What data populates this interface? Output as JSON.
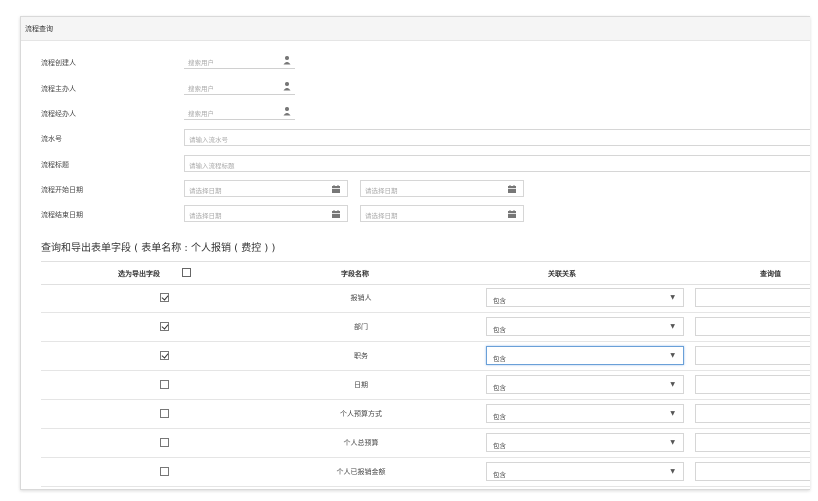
{
  "panel": {
    "title": "流程查询"
  },
  "form": {
    "creator": {
      "label": "流程创建人",
      "placeholder": "搜索用户",
      "icon": "user-icon"
    },
    "handler": {
      "label": "流程主办人",
      "placeholder": "搜索用户",
      "icon": "user-icon"
    },
    "participant": {
      "label": "流程经办人",
      "placeholder": "搜索用户",
      "icon": "user-icon"
    },
    "serial": {
      "label": "流水号",
      "placeholder": "请输入流水号"
    },
    "title": {
      "label": "流程标题",
      "placeholder": "请输入流程标题"
    },
    "start_date": {
      "label": "流程开始日期",
      "from_placeholder": "请选择日期",
      "to_placeholder": "请选择日期",
      "icon": "calendar-icon"
    },
    "end_date": {
      "label": "流程结束日期",
      "from_placeholder": "请选择日期",
      "to_placeholder": "请选择日期",
      "icon": "calendar-icon"
    }
  },
  "section": {
    "title": "查询和导出表单字段 ( 表单名称 : 个人报销 ( 费控 ) )"
  },
  "table": {
    "headers": {
      "export": "选为导出字段",
      "field": "字段名称",
      "relation": "关联关系",
      "value": "查询值"
    },
    "rows": [
      {
        "checked": true,
        "field": "报销人",
        "relation": "包含"
      },
      {
        "checked": true,
        "field": "部门",
        "relation": "包含"
      },
      {
        "checked": true,
        "field": "职务",
        "relation": "包含"
      },
      {
        "checked": false,
        "field": "日期",
        "relation": "包含"
      },
      {
        "checked": false,
        "field": "个人预算方式",
        "relation": "包含"
      },
      {
        "checked": false,
        "field": "个人总预算",
        "relation": "包含"
      },
      {
        "checked": false,
        "field": "个人已报销金额",
        "relation": "包含"
      }
    ]
  },
  "colors": {
    "focus_border": "#6aa0d8",
    "border": "#d6d6d6",
    "header_bg": "#f5f5f5"
  }
}
